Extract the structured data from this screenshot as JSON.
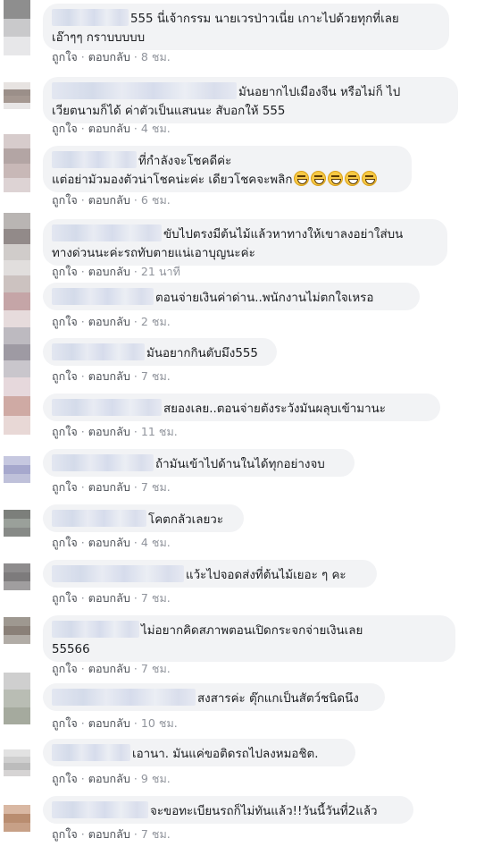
{
  "action_labels": {
    "like": "ถูกใจ",
    "reply": "ตอบกลับ",
    "sep": "·"
  },
  "comments": [
    {
      "lines": [
        "555 นี่เจ้ากรรม นายเวรป่าวเนี่ย เกาะไปด้วยทุกที่เลย",
        "เอ๊าๆๆ กราบบบบบ"
      ],
      "time": "8 ชม.",
      "avatar_colors": [
        "#8e8e8e",
        "#c9c9cb",
        "#e7e7e9"
      ]
    },
    {
      "lines": [
        "มันอยากไปเมืองจีน หรือไม่ก็ ไป",
        "เวียตนามก็ได้ ค่าตัวเป็นแสนนะ สับอกให้ 555"
      ],
      "time": "4 ชม.",
      "avatar_colors": [
        "#e7e3e1",
        "#9b8f89",
        "#a59891",
        "#e8e6e6"
      ]
    },
    {
      "lines": [
        "ที่กำลังจะโชคดีค่ะ",
        "แต่อย่ามัวมองตัวน่าโชคน่ะค่ะ เดียวโชคจะพลิก"
      ],
      "emoji_count": 5,
      "time": "6 ชม.",
      "avatar_colors": [
        "#d7cccc",
        "#b3a5a4",
        "#c8b8b7",
        "#ddd3d4"
      ]
    },
    {
      "lines": [
        "ขับไปตรงมีต้นไม้แล้วหาทางให้เขาลงอย่าใส่บน",
        "ทางด่วนนะค่ะรถทับตายแน่เอาบุญนะค่ะ"
      ],
      "time": "21 นาที",
      "avatar_colors": [
        "#b9b5b3",
        "#928a89",
        "#d0ccca",
        "#e1dedd"
      ]
    },
    {
      "lines": [
        "ตอนจ่ายเงินค่าด่าน..พนักงานไม่ตกใจเหรอ"
      ],
      "time": "2 ชม.",
      "avatar_colors": [
        "#ccc2c0",
        "#c5a5a7",
        "#e6dbdc"
      ]
    },
    {
      "lines": [
        "มันอยากกินตับมึง555"
      ],
      "time": "7 ชม.",
      "avatar_colors": [
        "#bdbac0",
        "#9e9aa3",
        "#c9c6cc"
      ]
    },
    {
      "lines": [
        "สยองเลย..ตอนจ่ายตังระวังมันผลุบเข้ามานะ"
      ],
      "time": "11 ชม.",
      "avatar_colors": [
        "#e6d8dc",
        "#cfaaa4",
        "#e8d8d6"
      ]
    },
    {
      "lines": [
        "ถ้ามันเข้าไปด้านในได้ทุกอย่างจบ"
      ],
      "time": "7 ชม.",
      "avatar_colors": [
        "#c6c8e0",
        "#a6a8cd",
        "#bfc1da"
      ]
    },
    {
      "lines": [
        "โคตกลัวเลยวะ"
      ],
      "time": "4 ชม.",
      "avatar_colors": [
        "#7c7f7b",
        "#9aa09a",
        "#878a87"
      ]
    },
    {
      "lines": [
        "แว้ะไปจอดส่งที่ต้นไม้เยอะ ๆ คะ"
      ],
      "time": "7 ชม.",
      "avatar_colors": [
        "#8e8c8d",
        "#7d7b7c",
        "#a09e9f"
      ]
    },
    {
      "lines": [
        "ไม่อยากคิดสภาพตอนเปิดกระจกจ่ายเงินเลย",
        "55566"
      ],
      "time": "7 ชม.",
      "avatar_colors": [
        "#9e9890",
        "#8a8078",
        "#b1aca6"
      ]
    },
    {
      "lines": [
        "สงสารค่ะ ตุ๊กแกเป็นสัตว์ชนิดนึง"
      ],
      "time": "10 ชม.",
      "avatar_colors": [
        "#cfcfcf",
        "#b9bdb4",
        "#a5aa9e"
      ]
    },
    {
      "lines": [
        "เอานา. มันแค่ขอติดรถไปลงหมอชิต."
      ],
      "time": "9 ชม.",
      "avatar_colors": [
        "#e2e2e2",
        "#cfcfcf",
        "#bcbcbc",
        "#d6d4d4"
      ]
    },
    {
      "lines": [
        "จะขอทะเบียนรถก็ไม่ทันแล้ว!!วันนี้วันที่2แล้ว"
      ],
      "time": "7 ชม.",
      "avatar_colors": [
        "#d9b8a3",
        "#b98d70",
        "#c7a087"
      ]
    }
  ]
}
